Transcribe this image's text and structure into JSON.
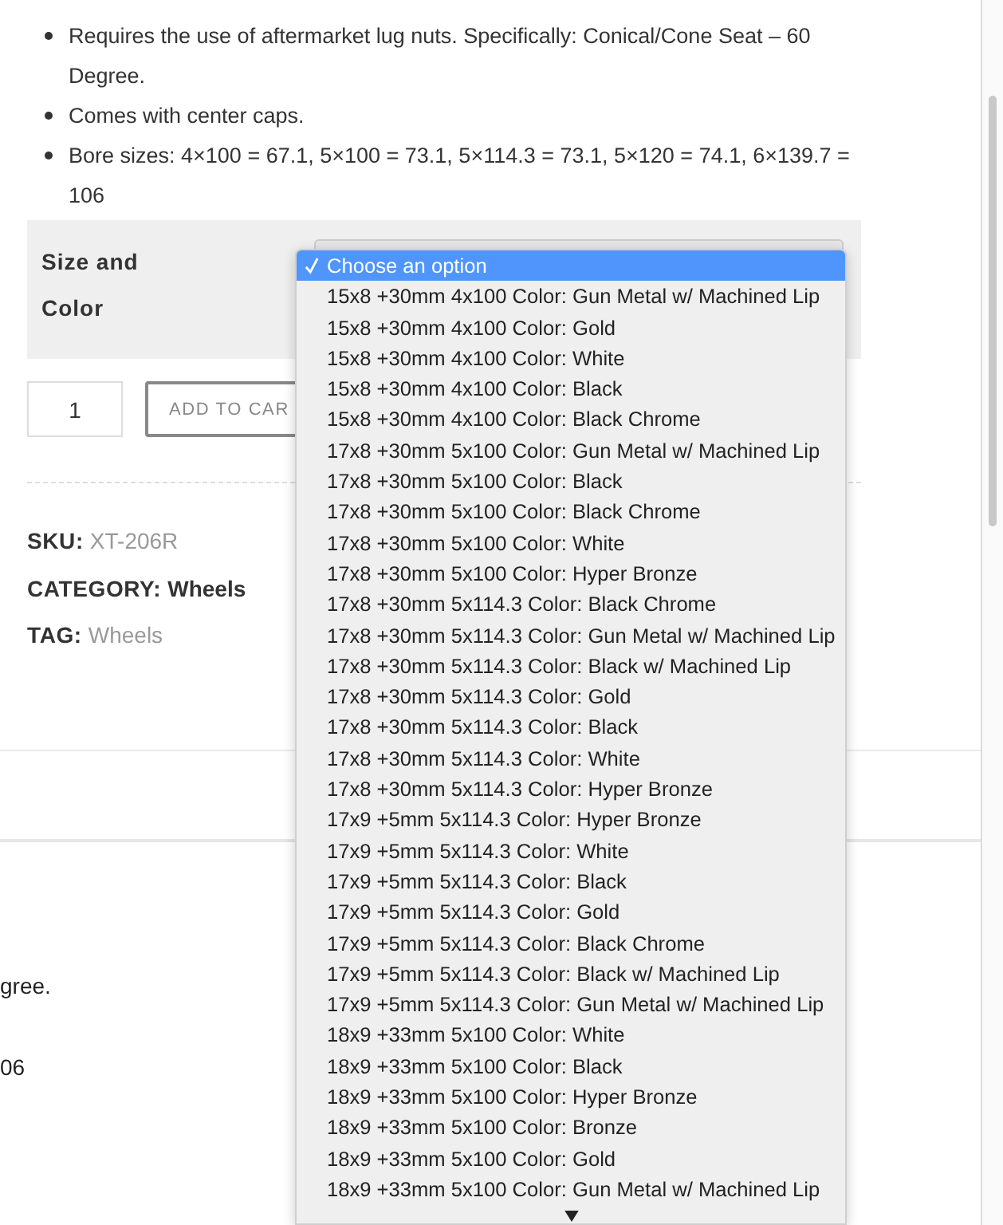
{
  "description": {
    "bullets": [
      "Requires the use of aftermarket lug nuts. Specifically: Conical/Cone Seat – 60 Degree.",
      "Comes with center caps.",
      "Bore sizes: 4×100 = 67.1, 5×100 = 73.1, 5×114.3 = 73.1, 5×120 = 74.1, 6×139.7 = 106"
    ]
  },
  "variation": {
    "label": "Size and Color",
    "dropdown": {
      "options": [
        {
          "label": "Choose an option",
          "selected": true
        },
        {
          "label": "15x8 +30mm 4x100 Color: Gun Metal w/ Machined Lip",
          "selected": false
        },
        {
          "label": "15x8 +30mm 4x100 Color: Gold",
          "selected": false
        },
        {
          "label": "15x8 +30mm 4x100 Color: White",
          "selected": false
        },
        {
          "label": "15x8 +30mm 4x100 Color: Black",
          "selected": false
        },
        {
          "label": "15x8 +30mm 4x100 Color: Black Chrome",
          "selected": false
        },
        {
          "label": "17x8 +30mm 5x100 Color: Gun Metal w/ Machined Lip",
          "selected": false
        },
        {
          "label": "17x8 +30mm 5x100 Color: Black",
          "selected": false
        },
        {
          "label": "17x8 +30mm 5x100 Color: Black Chrome",
          "selected": false
        },
        {
          "label": "17x8 +30mm 5x100 Color: White",
          "selected": false
        },
        {
          "label": "17x8 +30mm 5x100 Color: Hyper Bronze",
          "selected": false
        },
        {
          "label": "17x8 +30mm 5x114.3 Color: Black Chrome",
          "selected": false
        },
        {
          "label": "17x8 +30mm 5x114.3 Color: Gun Metal w/ Machined Lip",
          "selected": false
        },
        {
          "label": "17x8 +30mm 5x114.3 Color: Black w/ Machined Lip",
          "selected": false
        },
        {
          "label": "17x8 +30mm 5x114.3 Color: Gold",
          "selected": false
        },
        {
          "label": "17x8 +30mm 5x114.3 Color: Black",
          "selected": false
        },
        {
          "label": "17x8 +30mm 5x114.3 Color: White",
          "selected": false
        },
        {
          "label": "17x8 +30mm 5x114.3 Color: Hyper Bronze",
          "selected": false
        },
        {
          "label": "17x9 +5mm 5x114.3 Color: Hyper Bronze",
          "selected": false
        },
        {
          "label": "17x9 +5mm 5x114.3 Color: White",
          "selected": false
        },
        {
          "label": "17x9 +5mm 5x114.3 Color: Black",
          "selected": false
        },
        {
          "label": "17x9 +5mm 5x114.3 Color: Gold",
          "selected": false
        },
        {
          "label": "17x9 +5mm 5x114.3 Color: Black Chrome",
          "selected": false
        },
        {
          "label": "17x9 +5mm 5x114.3 Color: Black w/ Machined Lip",
          "selected": false
        },
        {
          "label": "17x9 +5mm 5x114.3 Color: Gun Metal w/ Machined Lip",
          "selected": false
        },
        {
          "label": "18x9 +33mm 5x100 Color: White",
          "selected": false
        },
        {
          "label": "18x9 +33mm 5x100 Color: Black",
          "selected": false
        },
        {
          "label": "18x9 +33mm 5x100 Color: Hyper Bronze",
          "selected": false
        },
        {
          "label": "18x9 +33mm 5x100 Color: Bronze",
          "selected": false
        },
        {
          "label": "18x9 +33mm 5x100 Color: Gold",
          "selected": false
        },
        {
          "label": "18x9 +33mm 5x100 Color: Gun Metal w/ Machined Lip",
          "selected": false
        }
      ]
    }
  },
  "quantity": {
    "value": "1"
  },
  "add_to_cart": {
    "label": "ADD TO CAR"
  },
  "meta": [
    {
      "key": "SKU:",
      "value": "XT-206R",
      "kind": "muted"
    },
    {
      "key": "CATEGORY:",
      "value": "Wheels",
      "kind": "strong"
    },
    {
      "key": "TAG:",
      "value": "Wheels",
      "kind": "muted"
    }
  ],
  "background_fragments": [
    "gree.",
    "06"
  ]
}
